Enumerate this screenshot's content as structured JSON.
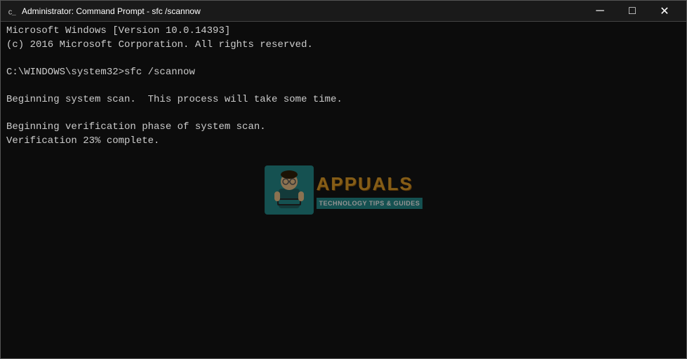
{
  "titleBar": {
    "icon": "cmd-icon",
    "title": "Administrator: Command Prompt - sfc  /scannow",
    "minimizeLabel": "─",
    "maximizeLabel": "□",
    "closeLabel": "✕"
  },
  "console": {
    "lines": [
      "Microsoft Windows [Version 10.0.14393]",
      "(c) 2016 Microsoft Corporation. All rights reserved.",
      "",
      "C:\\WINDOWS\\system32>sfc /scannow",
      "",
      "Beginning system scan.  This process will take some time.",
      "",
      "Beginning verification phase of system scan.",
      "Verification 23% complete."
    ]
  },
  "watermark": {
    "mascotEmoji": "🧑‍💻",
    "brandName": "APPUALS",
    "brandSubtitle": "TECHNOLOGY TIPS & GUIDES"
  }
}
